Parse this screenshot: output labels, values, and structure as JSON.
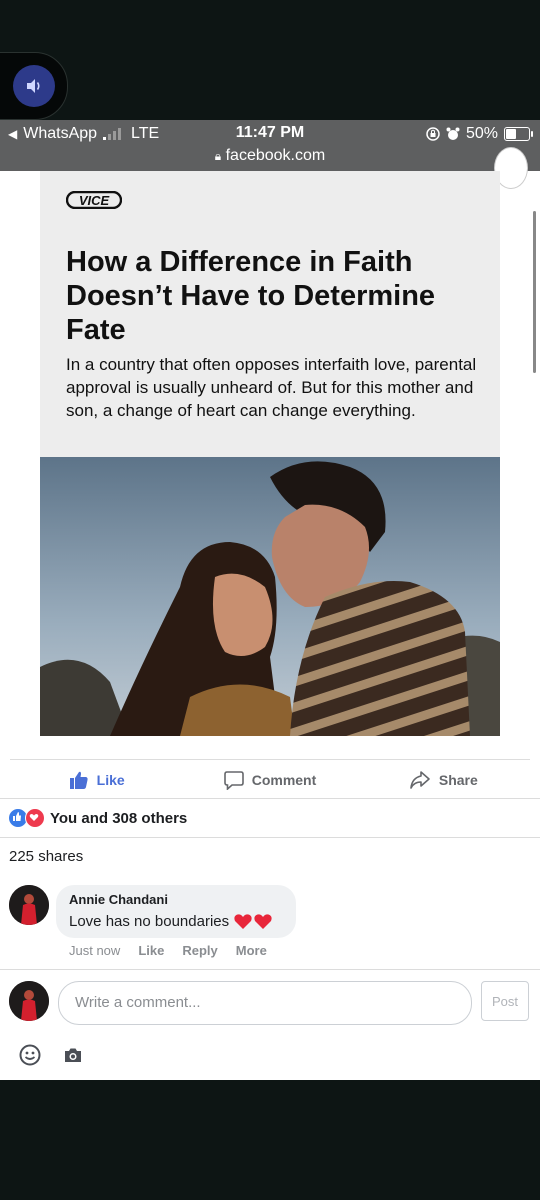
{
  "status": {
    "back_app": "WhatsApp",
    "network": "LTE",
    "time": "11:47 PM",
    "battery": "50%",
    "battery_level": 0.5,
    "url": "facebook.com"
  },
  "article": {
    "brand": "VICE",
    "headline": "How a Difference in Faith Doesn’t Have to Determine Fate",
    "subhead": "In a country that often opposes interfaith love, parental approval is usually unheard of. But for this mother and son, a change of heart can change everything."
  },
  "actions": {
    "like": "Like",
    "comment": "Comment",
    "share": "Share"
  },
  "reactions": {
    "text": "You and 308 others"
  },
  "shares": "225 shares",
  "comment": {
    "author": "Annie Chandani",
    "text": "Love has no boundaries",
    "time": "Just now",
    "like": "Like",
    "reply": "Reply",
    "more": "More"
  },
  "composer": {
    "placeholder": "Write a comment...",
    "post": "Post"
  },
  "colors": {
    "accent": "#4a6fd6",
    "status_bar": "#5e5f60",
    "heart": "#e8263a"
  }
}
